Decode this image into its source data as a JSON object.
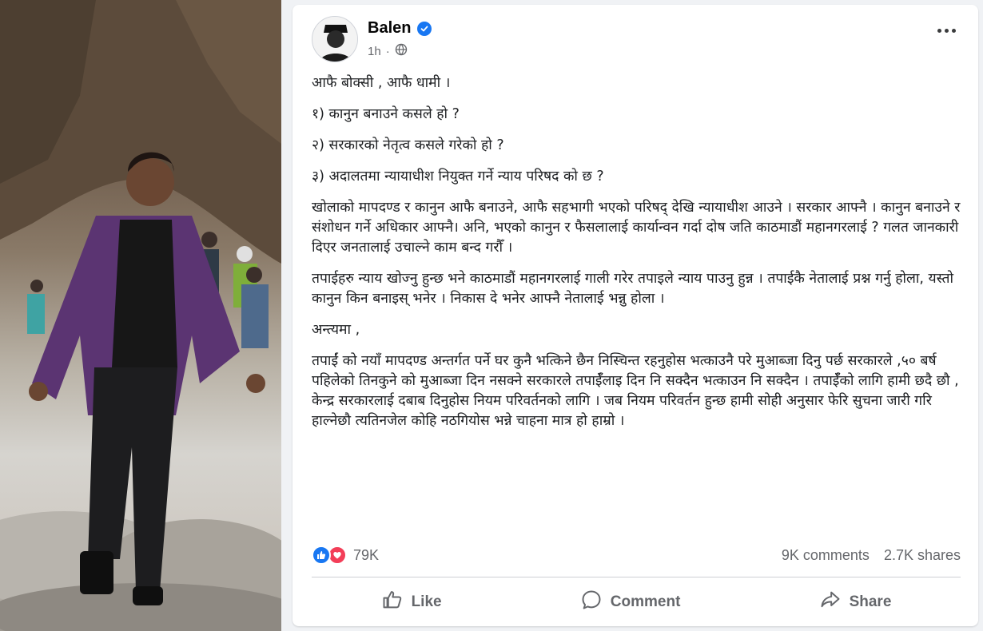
{
  "post": {
    "author": "Balen",
    "time": "1h",
    "paragraphs": [
      "आफै बोक्सी , आफै धामी  ।",
      "१) कानुन बनाउने कसले हो ?",
      "२) सरकारको नेतृत्व कसले गरेको हो ?",
      "३) अदालतमा न्यायाधीश नियुक्त गर्ने न्याय परिषद  को छ ?",
      "खोलाको मापदण्ड र कानुन आफै बनाउने, आफै सहभागी भएको परिषद् देखि न्यायाधीश आउने । सरकार आफ्नै । कानुन बनाउने र संशोधन गर्ने अधिकार आफ्नै।  अनि, भएको कानुन र फैसलालाई कार्यान्वन गर्दा दोष जति काठमाडौं महानगरलाई ? गलत जानकारी दिएर जनतालाई उचाल्ने काम बन्द गरौँ ।",
      "तपाईहरु न्याय खोज्नु हुन्छ भने काठमाडौं महानगरलाई गाली गरेर तपाइले न्याय पाउनु हुन्न । तपाईकै नेतालाई प्रश्न गर्नु होला, यस्तो कानुन किन बनाइस् भनेर । निकास दे भनेर आफ्नै नेतालाई भन्नु होला ।",
      "अन्त्यमा ,",
      "तपाईं को नयाँ मापदण्ड अन्तर्गत पर्ने घर कुनै भत्किने छैन निस्चिन्त रहनुहोस भत्काउनै परे मुआब्जा दिनु पर्छ सरकारले ,५० बर्ष पहिलेको तिनकुने को मुआब्जा दिन नसक्ने सरकारले तपाईँलाइ दिन नि सक्दैन भत्काउन नि सक्दैन  । तपाईँको लागि हामी छदै छौ , केन्द्र सरकारलाई दबाब दिनुहोस नियम परिवर्तनको लागि । जब नियम परिवर्तन हुन्छ हामी सोही अनुसार फेरि सुचना जारी गरि हाल्नेछौ त्यतिनजेल कोहि नठगियोस भन्ने चाहना मात्र हो हाम्रो ।"
    ]
  },
  "stats": {
    "reactions": "79K",
    "comments": "9K comments",
    "shares": "2.7K shares"
  },
  "actions": {
    "like": "Like",
    "comment": "Comment",
    "share": "Share"
  },
  "colors": {
    "accent": "#1877f2",
    "love": "#f33e58",
    "muted": "#65676b"
  }
}
